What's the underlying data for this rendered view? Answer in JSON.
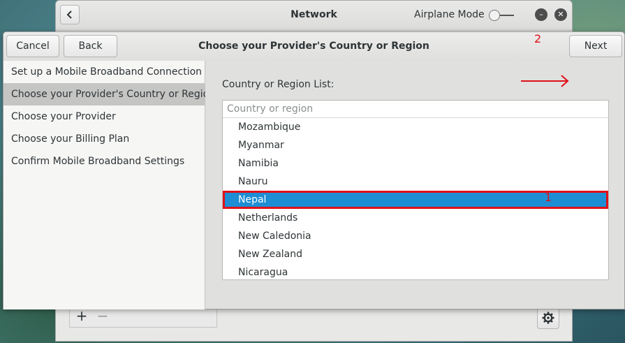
{
  "background_window": {
    "title": "Network",
    "airplane_mode_label": "Airplane Mode",
    "plus_label": "+",
    "minus_label": "−"
  },
  "dialog": {
    "title": "Choose your Provider's Country or Region",
    "cancel_label": "Cancel",
    "back_label": "Back",
    "next_label": "Next",
    "steps": [
      {
        "label": "Set up a Mobile Broadband Connection",
        "active": false
      },
      {
        "label": "Choose your Provider's Country or Region",
        "active": true
      },
      {
        "label": "Choose your Provider",
        "active": false
      },
      {
        "label": "Choose your Billing Plan",
        "active": false
      },
      {
        "label": "Confirm Mobile Broadband Settings",
        "active": false
      }
    ],
    "list_label": "Country or Region List:",
    "list_column_header": "Country or region",
    "countries": [
      "Mozambique",
      "Myanmar",
      "Namibia",
      "Nauru",
      "Nepal",
      "Netherlands",
      "New Caledonia",
      "New Zealand",
      "Nicaragua"
    ],
    "selected_country": "Nepal"
  },
  "annotations": {
    "marker_1": "1",
    "marker_2": "2",
    "color": "#e0101a"
  },
  "colors": {
    "selection": "#1d8dd4",
    "sidebar_active": "#c5c5c4"
  }
}
